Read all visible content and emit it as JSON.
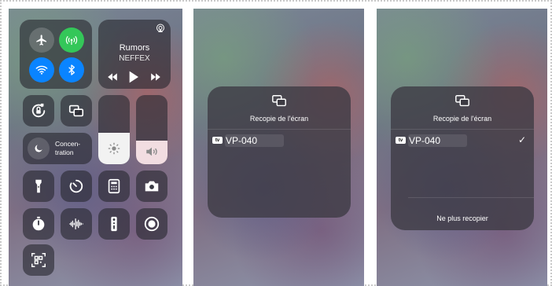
{
  "control_center": {
    "connectivity": {
      "airplane_icon": "airplane-icon",
      "cellular_icon": "cellular-data-icon",
      "wifi_icon": "wifi-icon",
      "bluetooth_icon": "bluetooth-icon"
    },
    "now_playing": {
      "title": "Rumors",
      "artist": "NEFFEX"
    },
    "focus": {
      "label_line1": "Concen-",
      "label_line2": "tration"
    },
    "colors": {
      "green": "#34c759",
      "blue": "#0a84ff",
      "tile": "#2e2e36"
    }
  },
  "screen_mirroring_sheet": {
    "title": "Recopie de l'écran",
    "device_badge": "tv",
    "device_name": "VP-040"
  },
  "screen_mirroring_sheet_connected": {
    "title": "Recopie de l'écran",
    "device_badge": "tv",
    "device_name": "VP-040",
    "checkmark": "✓",
    "stop_label": "Ne plus recopier"
  }
}
